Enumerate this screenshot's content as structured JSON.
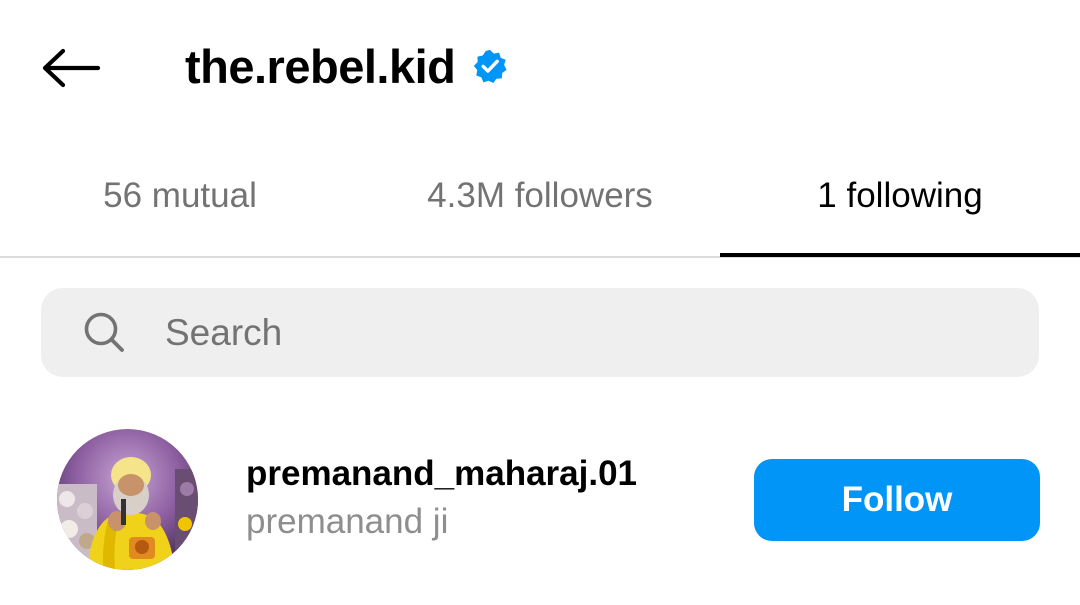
{
  "header": {
    "title": "the.rebel.kid",
    "verified": true,
    "back_icon": "arrow-left-icon",
    "verified_icon": "verified-badge-icon"
  },
  "tabs": [
    {
      "label": "56 mutual",
      "active": false
    },
    {
      "label": "4.3M followers",
      "active": false
    },
    {
      "label": "1 following",
      "active": true
    }
  ],
  "search": {
    "placeholder": "Search",
    "value": "",
    "icon": "search-icon"
  },
  "following": [
    {
      "username": "premanand_maharaj.01",
      "full_name": "premanand ji",
      "button_label": "Follow"
    }
  ],
  "colors": {
    "accent": "#0095f6",
    "verified": "#0095f6",
    "secondary_text": "#737373",
    "search_bg": "#efefef"
  }
}
